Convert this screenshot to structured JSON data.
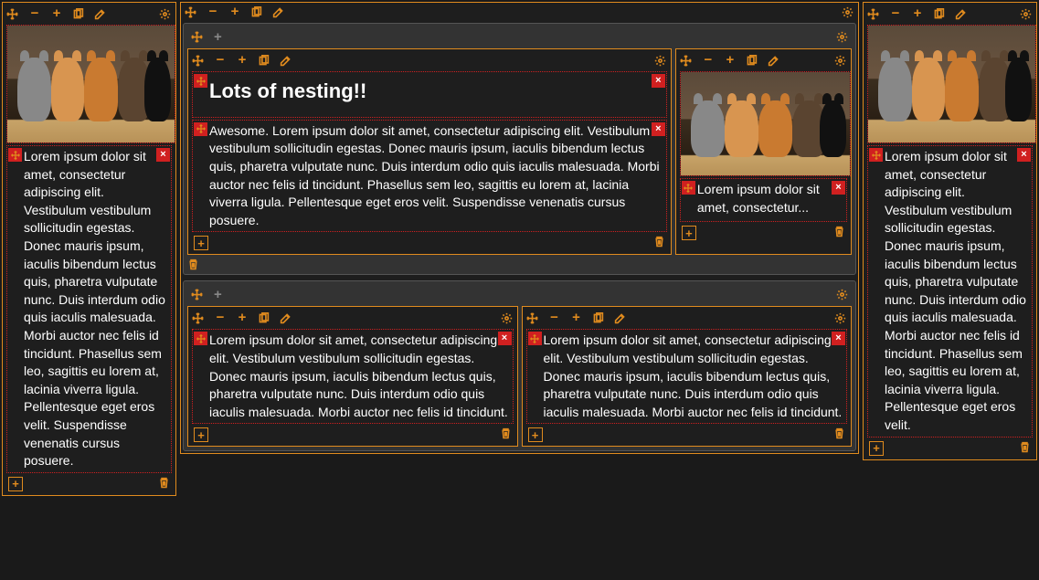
{
  "headings": {
    "nesting": "Lots of nesting!!"
  },
  "text": {
    "lorem_full": "Lorem ipsum dolor sit amet, consectetur adipiscing elit. Vestibulum vestibulum sollicitudin egestas. Donec mauris ipsum, iaculis bibendum lectus quis, pharetra vulputate nunc. Duis interdum odio quis iaculis malesuada. Morbi auctor nec felis id tincidunt. Phasellus sem leo, sagittis eu lorem at, lacinia viverra ligula. Pellentesque eget eros velit. Suspendisse venenatis cursus posuere.",
    "awesome": "Awesome. Lorem ipsum dolor sit amet, consectetur adipiscing elit. Vestibulum vestibulum sollicitudin egestas. Donec mauris ipsum, iaculis bibendum lectus quis, pharetra vulputate nunc. Duis interdum odio quis iaculis malesuada. Morbi auctor nec felis id tincidunt. Phasellus sem leo, sagittis eu lorem at, lacinia viverra ligula. Pellentesque eget eros velit. Suspendisse venenatis cursus posuere.",
    "lorem_trunc": "Lorem ipsum dolor sit amet, consectetur...",
    "lorem_med": "Lorem ipsum dolor sit amet, consectetur adipiscing elit. Vestibulum vestibulum sollicitudin egestas. Donec mauris ipsum, iaculis bibendum lectus quis, pharetra vulputate nunc. Duis interdum odio quis iaculis malesuada. Morbi auctor nec felis id tincidunt.",
    "lorem_right": "Lorem ipsum dolor sit amet, consectetur adipiscing elit. Vestibulum vestibulum sollicitudin egestas. Donec mauris ipsum, iaculis bibendum lectus quis, pharetra vulputate nunc. Duis interdum odio quis iaculis malesuada. Morbi auctor nec felis id tincidunt. Phasellus sem leo, sagittis eu lorem at, lacinia viverra ligula. Pellentesque eget eros velit."
  },
  "icons": {
    "move": "move-icon",
    "minus": "minus-icon",
    "plus": "plus-icon",
    "copy": "copy-icon",
    "edit": "edit-icon",
    "gear": "gear-icon",
    "close": "close-icon",
    "trash": "trash-icon",
    "add_box": "add-box-icon"
  },
  "colors": {
    "accent": "#e08b1e",
    "danger": "#d02020",
    "bg": "#1a1a1a",
    "grey_box": "#333333"
  }
}
